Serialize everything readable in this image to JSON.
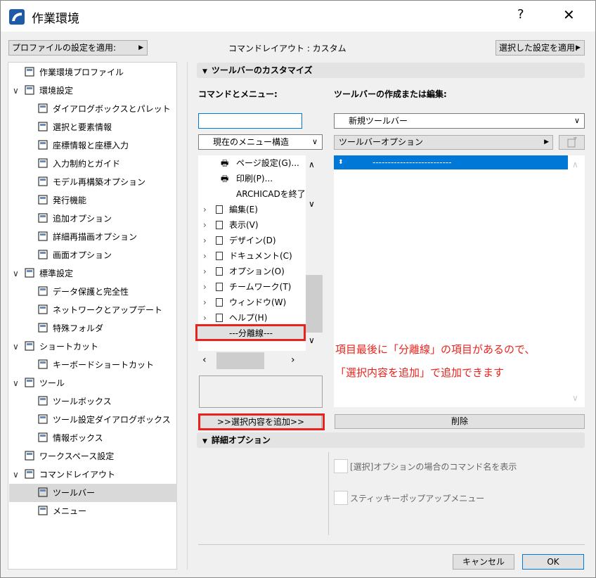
{
  "window": {
    "title": "作業環境",
    "help": "?",
    "close": "✕"
  },
  "topbar": {
    "apply_profile": "プロファイルの設定を適用:",
    "layout_label": "コマンドレイアウト : カスタム",
    "apply_selected": "選択した設定を適用:"
  },
  "tree": [
    {
      "label": "作業環境プロファイル",
      "icon": "profile-icon",
      "indent": 0
    },
    {
      "label": "環境設定",
      "icon": "settings-icon",
      "indent": 0,
      "chev": "∨"
    },
    {
      "label": "ダイアログボックスとパレット",
      "icon": "dialog-icon",
      "indent": 1
    },
    {
      "label": "選択と要素情報",
      "icon": "selection-icon",
      "indent": 1
    },
    {
      "label": "座標情報と座標入力",
      "icon": "xyz-icon",
      "indent": 1
    },
    {
      "label": "入力制約とガイド",
      "icon": "mouse-icon",
      "indent": 1
    },
    {
      "label": "モデル再構築オプション",
      "icon": "rebuild-icon",
      "indent": 1
    },
    {
      "label": "発行機能",
      "icon": "publish-icon",
      "indent": 1
    },
    {
      "label": "追加オプション",
      "icon": "sliders-icon",
      "indent": 1
    },
    {
      "label": "詳細再描画オプション",
      "icon": "redraw-icon",
      "indent": 1
    },
    {
      "label": "画面オプション",
      "icon": "monitor-icon",
      "indent": 1
    },
    {
      "label": "標準設定",
      "icon": "standard-icon",
      "indent": 0,
      "chev": "∨"
    },
    {
      "label": "データ保護と完全性",
      "icon": "shield-icon",
      "indent": 1
    },
    {
      "label": "ネットワークとアップデート",
      "icon": "globe-icon",
      "indent": 1
    },
    {
      "label": "特殊フォルダ",
      "icon": "folder-icon",
      "indent": 1
    },
    {
      "label": "ショートカット",
      "icon": "shortcut-icon",
      "indent": 0,
      "chev": "∨"
    },
    {
      "label": "キーボードショートカット",
      "icon": "arrow-shortcut-icon",
      "indent": 1
    },
    {
      "label": "ツール",
      "icon": "tool-icon",
      "indent": 0,
      "chev": "∨"
    },
    {
      "label": "ツールボックス",
      "icon": "toolbox-icon",
      "indent": 1
    },
    {
      "label": "ツール設定ダイアログボックス",
      "icon": "tool-settings-icon",
      "indent": 1
    },
    {
      "label": "情報ボックス",
      "icon": "infobox-icon",
      "indent": 1
    },
    {
      "label": "ワークスペース設定",
      "icon": "workspace-icon",
      "indent": 0
    },
    {
      "label": "コマンドレイアウト",
      "icon": "command-layout-icon",
      "indent": 0,
      "chev": "∨"
    },
    {
      "label": "ツールバー",
      "icon": "toolbar-icon",
      "indent": 1,
      "selected": true
    },
    {
      "label": "メニュー",
      "icon": "menu-icon",
      "indent": 1
    }
  ],
  "customize": {
    "header": "ツールバーのカスタマイズ",
    "commands_label": "コマンドとメニュー:",
    "toolbar_label": "ツールバーの作成または編集:",
    "search_value": "",
    "menu_structure": "現在のメニュー構造",
    "new_toolbar": "新規ツールバー",
    "toolbar_options": "ツールバーオプション",
    "command_items": [
      {
        "label": "ページ設定(G)...",
        "type": "sub"
      },
      {
        "label": "印刷(P)...",
        "type": "sub"
      },
      {
        "label": "ARCHICADを終了(",
        "type": "plain"
      },
      {
        "label": "編集(E)",
        "type": "menu"
      },
      {
        "label": "表示(V)",
        "type": "menu"
      },
      {
        "label": "デザイン(D)",
        "type": "menu"
      },
      {
        "label": "ドキュメント(C)",
        "type": "menu"
      },
      {
        "label": "オプション(O)",
        "type": "menu"
      },
      {
        "label": "チームワーク(T)",
        "type": "menu"
      },
      {
        "label": "ウィンドウ(W)",
        "type": "menu"
      },
      {
        "label": "ヘルプ(H)",
        "type": "menu"
      },
      {
        "label": "---分離線---",
        "type": "separator"
      }
    ],
    "toolbar_items": [
      {
        "label": "--------------------------"
      }
    ],
    "add_button": ">>選択内容を追加>>",
    "delete_button": "削除"
  },
  "annotation": {
    "line1": "項目最後に「分離線」の項目があるので、",
    "line2": "「選択内容を追加」で追加できます"
  },
  "advanced": {
    "header": "詳細オプション",
    "option1": "[選択]オプションの場合のコマンド名を表示",
    "option2": "スティッキーポップアップメニュー"
  },
  "footer": {
    "cancel": "キャンセル",
    "ok": "OK"
  },
  "colors": {
    "accent": "#0078d7",
    "annotation": "#e8231d"
  }
}
